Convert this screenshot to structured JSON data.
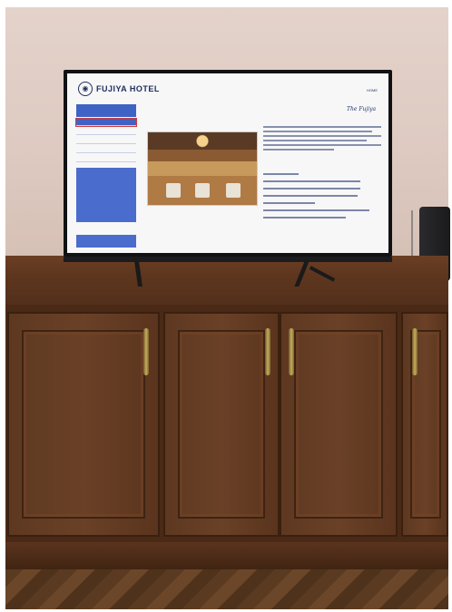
{
  "scene": {
    "description_type": "photo",
    "colors": {
      "wall": "#ddc9c0",
      "cabinet": "#5e361e",
      "tv_frame": "#111214",
      "accent_blue": "#3f63c4"
    }
  },
  "tv_screen": {
    "logo_text": "FUJIYA HOTEL",
    "top_right_link": "HOME",
    "script_logo_small": "",
    "script_logo": "The Fujiya",
    "sidebar_header": "",
    "sidebar_items": [
      "",
      "",
      "",
      "",
      ""
    ],
    "section_label": ""
  }
}
